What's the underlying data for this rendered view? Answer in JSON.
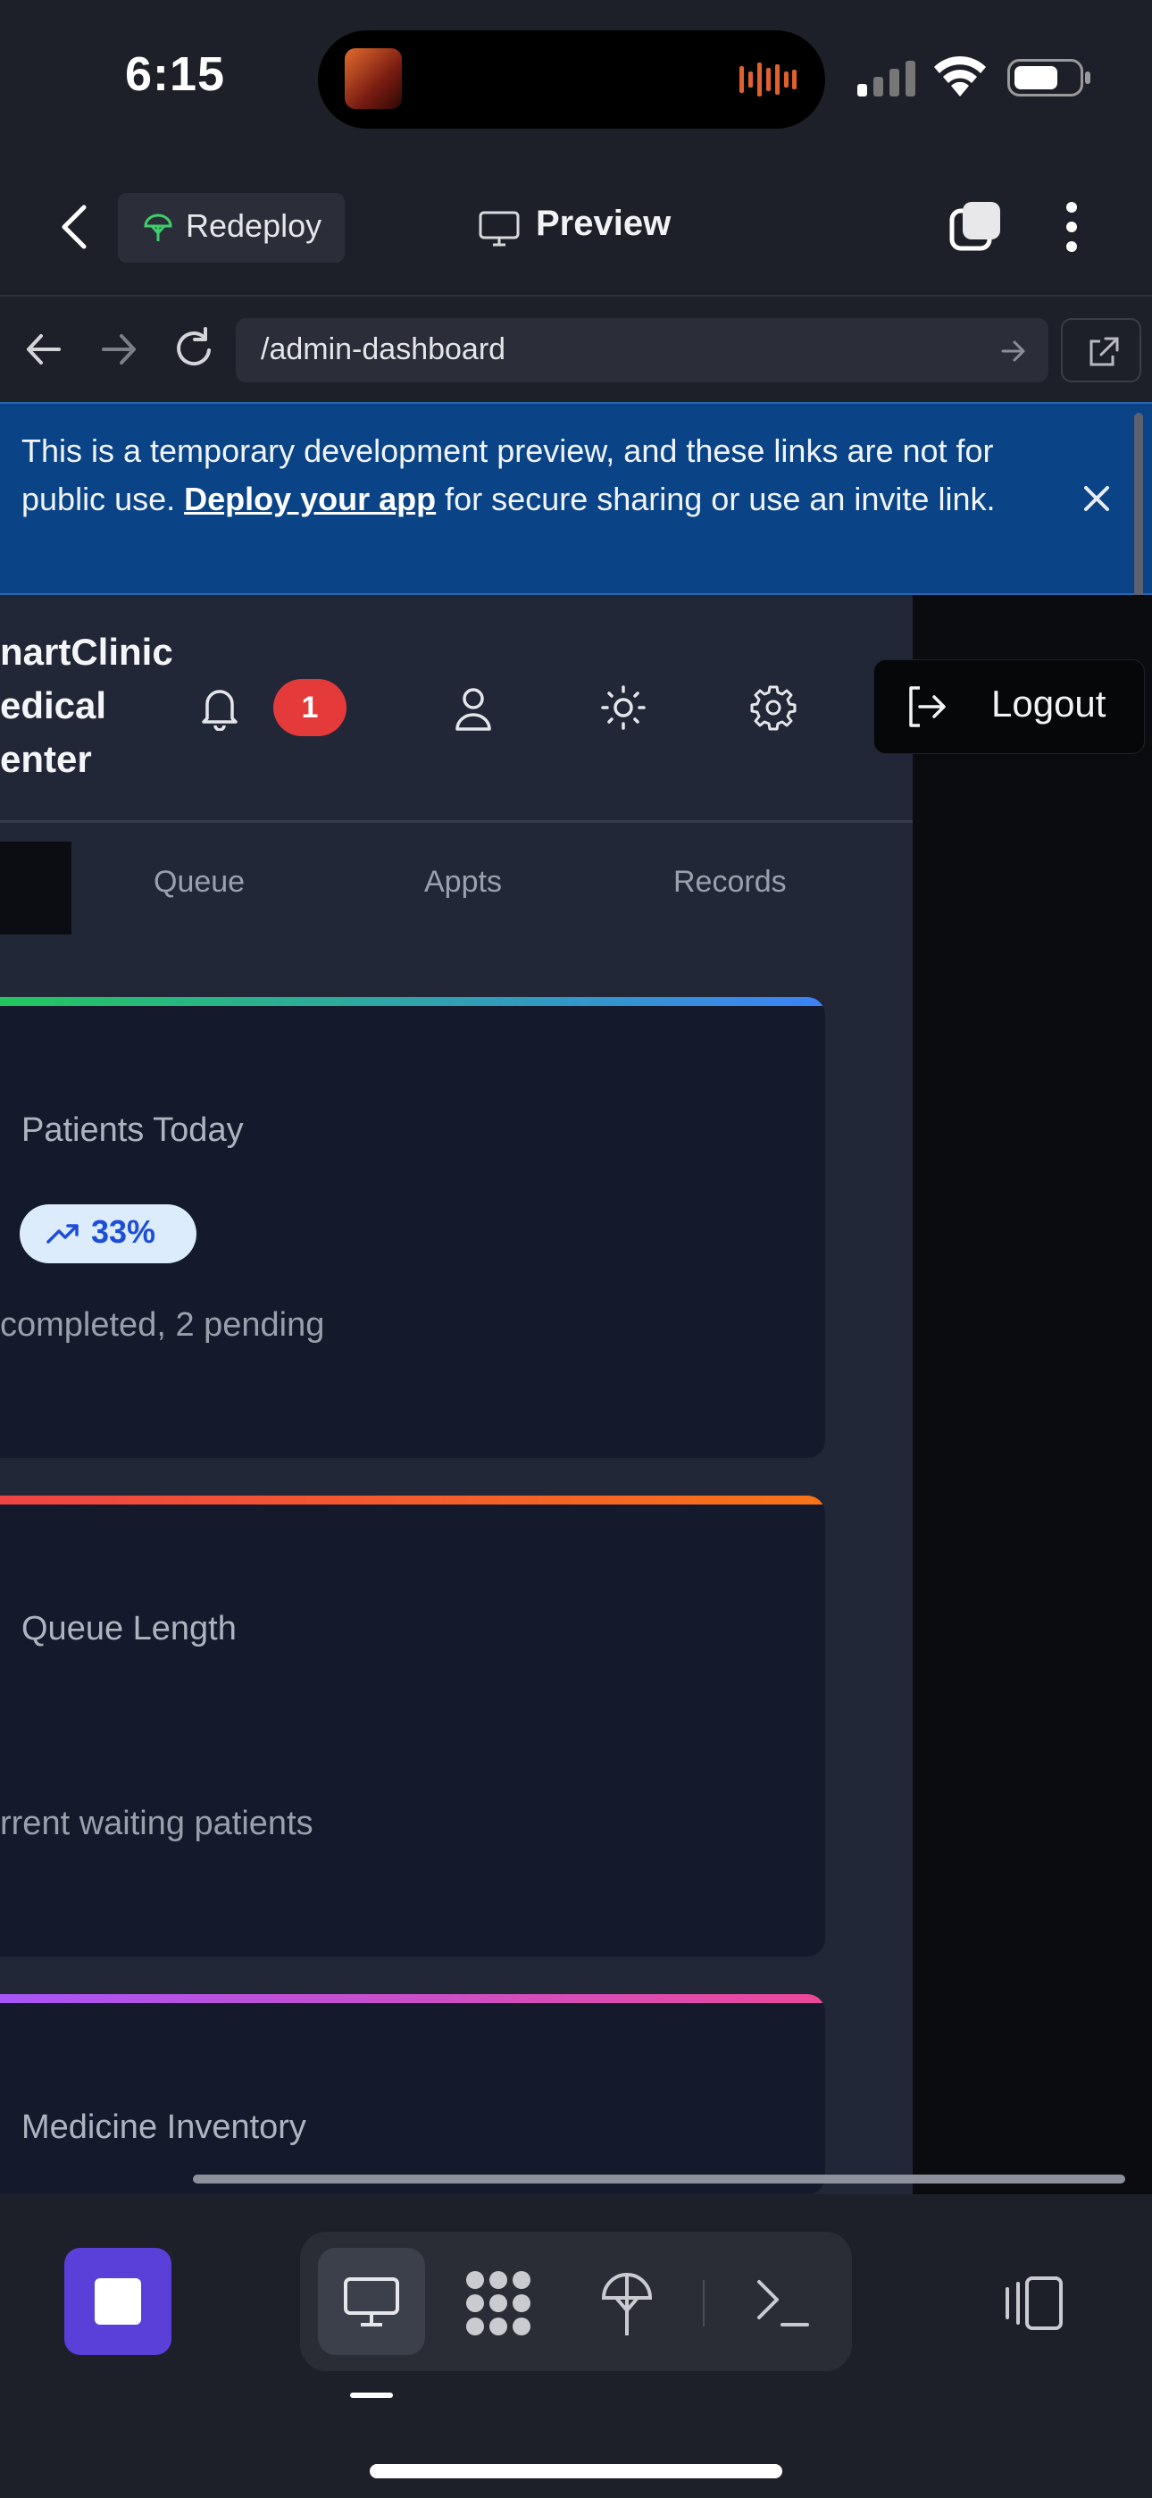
{
  "status_bar": {
    "time": "6:15"
  },
  "app_header": {
    "redeploy_label": "Redeploy",
    "preview_label": "Preview"
  },
  "browser": {
    "url": "/admin-dashboard"
  },
  "banner": {
    "text_before": "This is a temporary development preview, and these links are not for public use. ",
    "link_text": "Deploy your app",
    "text_after": " for secure sharing or use an invite link."
  },
  "page": {
    "clinic_name_lines": [
      "nartClinic",
      "edical",
      "enter"
    ],
    "notification_count": "1",
    "logout_label": "Logout",
    "tabs": [
      "Queue",
      "Appts",
      "Records"
    ],
    "cards": [
      {
        "title": "Patients Today",
        "trend": "33%",
        "subtitle": "completed, 2 pending"
      },
      {
        "title": "Queue Length",
        "subtitle": "rrent waiting patients"
      },
      {
        "title": "Medicine Inventory"
      }
    ]
  },
  "colors": {
    "banner_bg": "#0a4487",
    "badge_red": "#e53a3a",
    "stop_button": "#5b3fd9",
    "card1_stripe": [
      "#22c55e",
      "#3b82f6"
    ],
    "card2_stripe": [
      "#ef4444",
      "#f97316"
    ],
    "card3_stripe": [
      "#a855f7",
      "#ec4899"
    ]
  },
  "icons": {
    "header": [
      "back-icon",
      "redeploy-icon",
      "preview-icon",
      "tabs-icon",
      "more-icon"
    ],
    "browser": [
      "nav-back-icon",
      "nav-forward-icon",
      "reload-icon",
      "url-go-icon",
      "open-external-icon"
    ],
    "page": [
      "bell-icon",
      "user-icon",
      "sun-icon",
      "gear-icon",
      "logout-icon",
      "trend-up-icon"
    ],
    "toolbar": [
      "stop-icon",
      "preview-icon",
      "workflow-icon",
      "deploy-icon",
      "shell-icon",
      "layout-icon"
    ]
  }
}
